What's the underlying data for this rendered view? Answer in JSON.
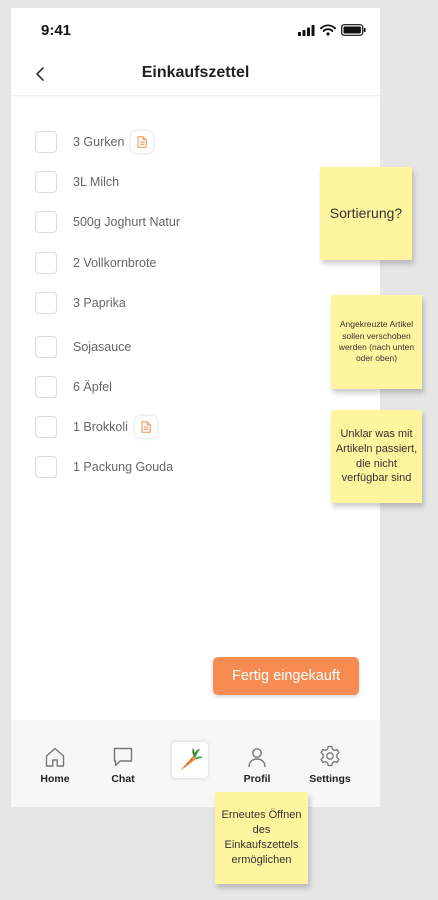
{
  "status_bar": {
    "time": "9:41"
  },
  "header": {
    "title": "Einkaufszettel"
  },
  "items": [
    {
      "label": "3  Gurken",
      "has_note": true
    },
    {
      "label": "3L Milch",
      "has_note": false
    },
    {
      "label": "500g Joghurt Natur",
      "has_note": false
    },
    {
      "label": "2 Vollkornbrote",
      "has_note": false
    },
    {
      "label": "3 Paprika",
      "has_note": false
    },
    {
      "label": "Sojasauce",
      "has_note": false
    },
    {
      "label": "6 Äpfel",
      "has_note": false
    },
    {
      "label": "1 Brokkoli",
      "has_note": true
    },
    {
      "label": "1 Packung Gouda",
      "has_note": false
    }
  ],
  "cta": {
    "label": "Fertig eingekauft"
  },
  "tabbar": {
    "home": "Home",
    "chat": "Chat",
    "profil": "Profil",
    "settings": "Settings"
  },
  "annotations": {
    "sortierung": "Sortierung?",
    "angekreuzte": "Angekreuzte Artikel sollen verschoben werden (nach unten oder oben)",
    "unklar": "Unklar was mit Artikeln passiert, die nicht verfügbar sind",
    "erneutes": "Erneutes Öffnen des Einkaufszettels ermöglichen"
  },
  "colors": {
    "accent": "#f68c51",
    "sticky": "#fff59f",
    "background": "#e6e6e6"
  },
  "icons": {
    "back": "chevron-left-icon",
    "note": "document-icon",
    "home": "home-icon",
    "chat": "chat-bubble-icon",
    "center": "carrot-icon",
    "profil": "user-icon",
    "settings": "gear-icon"
  }
}
